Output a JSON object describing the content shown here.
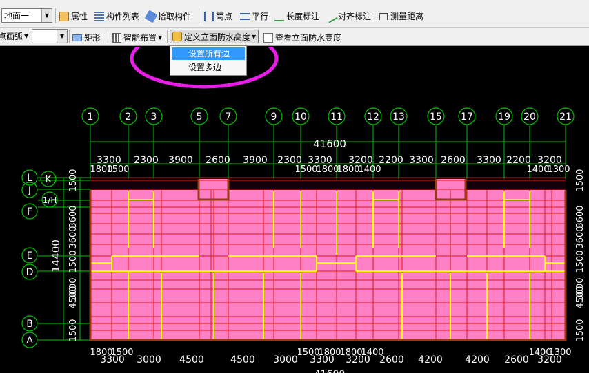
{
  "toolbar1": {
    "floor_select": "地面一",
    "items": [
      "属性",
      "构件列表",
      "拾取构件",
      "两点",
      "平行",
      "长度标注",
      "对齐标注",
      "测量距离"
    ]
  },
  "toolbar2": {
    "mode_select": "点画弧",
    "rect_label": "矩形",
    "smart_layout_label": "智能布置",
    "define_height_label": "定义立面防水高度",
    "view_height_label": "查看立面防水高度"
  },
  "dropdown": {
    "items": [
      "设置所有边",
      "设置多边"
    ]
  },
  "colors": {
    "fill": "#ff7fc4",
    "grid_line": "#e01818",
    "wall_yellow": "#ffff00",
    "axis_green": "#00c800",
    "highlight_ring": "#e81ee8",
    "wall_brown": "#9a3a10"
  },
  "drawing": {
    "column_axes": [
      "1",
      "2",
      "3",
      "5",
      "7",
      "9",
      "10",
      "11",
      "12",
      "13",
      "15",
      "17",
      "19",
      "20",
      "21"
    ],
    "row_axes": [
      "L",
      "K",
      "J",
      "1/H",
      "F",
      "E",
      "D",
      "B",
      "A"
    ],
    "total_width": "41600",
    "total_height": "14400",
    "top_dims": [
      "3300",
      "2300",
      "3900",
      "2600",
      "3900",
      "2300",
      "3300",
      "3200",
      "2200",
      "3300",
      "2600",
      "3300",
      "2200",
      "3200"
    ],
    "top_small_left": "1800",
    "top_small_left_2": "1500",
    "top_small_mid": "1500",
    "top_small_mid_2": "1800",
    "top_small_mid_3": "1800",
    "top_small_mid_4": "1400",
    "top_small_right": "1400",
    "top_small_right_2": "1300",
    "bottom_dims": [
      "3300",
      "3000",
      "4500",
      "4500",
      "3000",
      "3300",
      "3200",
      "2600",
      "4200",
      "4200",
      "2600",
      "3200"
    ],
    "bottom_small_left": "1800",
    "bottom_small_left_2": "1500",
    "bottom_small_mid": "1500",
    "bottom_small_mid_2": "1800",
    "bottom_small_mid_3": "1800",
    "bottom_small_mid_4": "1400",
    "bottom_small_right": "1400",
    "bottom_small_right_2": "1300",
    "left_dims": [
      "1500",
      "4500",
      "3000",
      "1500",
      "3600",
      "3600",
      "1500"
    ],
    "bottom_total": "41600"
  }
}
